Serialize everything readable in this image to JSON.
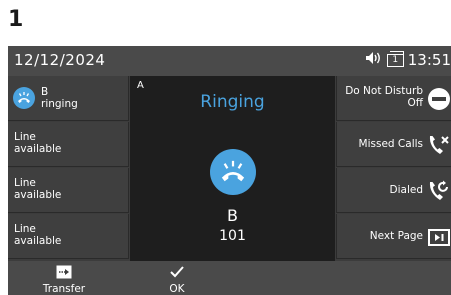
{
  "step_number": "1",
  "status_bar": {
    "date": "12/12/2024",
    "line_indicator": "1",
    "time": "13:51",
    "icons": [
      "speaker-volume-icon",
      "line-indicator-icon"
    ]
  },
  "left_keys": [
    {
      "name": "B",
      "state": "ringing",
      "icon": "ringing-handset-icon"
    },
    {
      "line1": "Line",
      "line2": "available"
    },
    {
      "line1": "Line",
      "line2": "available"
    },
    {
      "line1": "Line",
      "line2": "available"
    }
  ],
  "call_panel": {
    "tag": "A",
    "title": "Ringing",
    "caller_name": "B",
    "caller_number": "101",
    "icon": "ringing-handset-icon"
  },
  "right_keys": [
    {
      "line1": "Do Not Disturb",
      "line2": "Off",
      "icon": "do-not-disturb-icon"
    },
    {
      "label": "Missed Calls",
      "icon": "missed-calls-icon"
    },
    {
      "label": "Dialed",
      "icon": "dialed-calls-icon"
    },
    {
      "label": "Next Page",
      "icon": "next-page-icon"
    }
  ],
  "softkeys": [
    {
      "label": "Transfer",
      "icon": "transfer-icon"
    },
    {
      "label": "OK",
      "icon": "checkmark-icon"
    }
  ],
  "colors": {
    "accent": "#4aa3df",
    "screen_bg": "#3c3c3c",
    "panel_bg": "#1e1e1e",
    "text": "#ffffff"
  }
}
